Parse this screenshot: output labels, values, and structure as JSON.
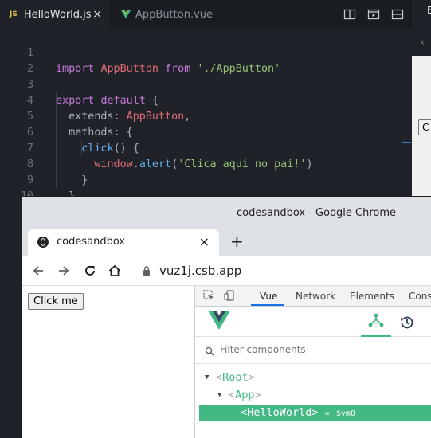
{
  "editor": {
    "tabs": [
      {
        "badge": "JS",
        "label": "HelloWorld.js",
        "active": true,
        "close": "×"
      },
      {
        "label": "AppButton.vue",
        "active": false
      }
    ],
    "lines": {
      "n1": "1",
      "n2": "2",
      "n3": "3",
      "n4": "4",
      "n5": "5",
      "n6": "6",
      "n7": "7",
      "n8": "8",
      "n9": "9",
      "n10": "10",
      "l1": {
        "a": "import",
        "b": "AppButton",
        "c": "from",
        "d": "'./AppButton'"
      },
      "l3": {
        "a": "export",
        "b": "default",
        "c": "{"
      },
      "l4": {
        "a": "extends",
        "b": ":",
        "c": "AppButton",
        "d": ","
      },
      "l5": {
        "a": "methods",
        "b": ": {"
      },
      "l6": {
        "a": "click",
        "b": "() {"
      },
      "l7": {
        "a": "window",
        "b": ".",
        "c": "alert",
        "d": "(",
        "e": "'Clica aqui no pai!'",
        "f": ")"
      },
      "l8": "}",
      "l9": "}",
      "l10": "}"
    }
  },
  "side_window": {
    "letter": "E",
    "chevron": "‹",
    "button_label": "C"
  },
  "chrome": {
    "window_title": "codesandbox - Google Chrome",
    "tab_title": "codesandbox",
    "tab_close": "×",
    "new_tab": "+",
    "url": "vuz1j.csb.app",
    "page": {
      "button_label": "Click me"
    },
    "devtools": {
      "tabs": [
        "Vue",
        "Network",
        "Elements",
        "Cons"
      ],
      "active_tab": "Vue",
      "filter_placeholder": "Filter components",
      "tree": [
        {
          "name": "Root",
          "open": "<",
          "close": ">"
        },
        {
          "name": "App",
          "open": "<",
          "close": ">"
        },
        {
          "name": "HelloWorld",
          "open": "<",
          "close": ">",
          "suffix_eq": "=",
          "suffix_vm": "$vm0",
          "selected": true
        }
      ]
    }
  },
  "colors": {
    "vue_green": "#42b883",
    "accent_blue": "#1a73e8"
  }
}
